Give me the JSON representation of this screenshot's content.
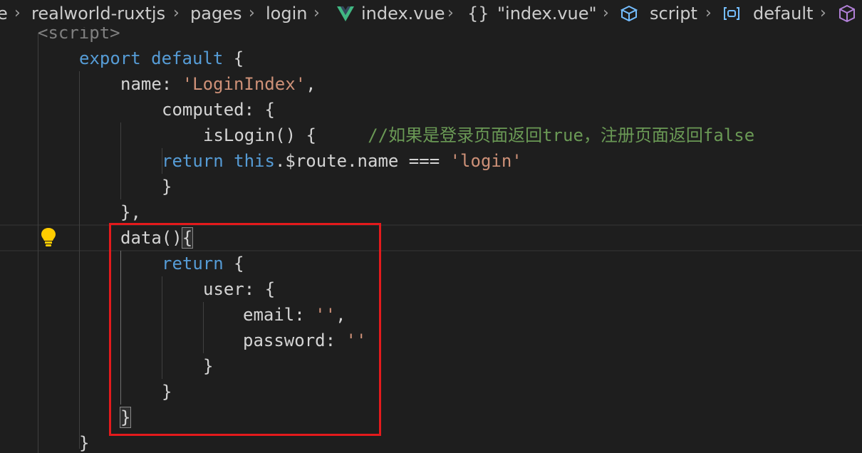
{
  "breadcrumb": {
    "items": [
      {
        "label": "e",
        "icon": null
      },
      {
        "label": "realworld-ruxtjs",
        "icon": null
      },
      {
        "label": "pages",
        "icon": null
      },
      {
        "label": "login",
        "icon": null
      },
      {
        "label": "index.vue",
        "icon": "vue-icon"
      },
      {
        "label": "\"index.vue\"",
        "icon": "braces-icon"
      },
      {
        "label": "script",
        "icon": "cube-icon"
      },
      {
        "label": "default",
        "icon": "object-icon"
      }
    ],
    "separator": "›",
    "braces_glyph": "{}",
    "colors": {
      "vue": "#41b883",
      "cube": "#75beff",
      "object": "#75beff",
      "module": "#b180d7"
    }
  },
  "code": {
    "lines": [
      {
        "tokens": [
          {
            "t": "<script>",
            "c": "tag"
          }
        ]
      },
      {
        "tokens": [
          {
            "t": "export",
            "c": "kw"
          },
          {
            "t": " ",
            "c": ""
          },
          {
            "t": "default",
            "c": "kw"
          },
          {
            "t": " {",
            "c": ""
          }
        ]
      },
      {
        "tokens": [
          {
            "t": "name: ",
            "c": ""
          },
          {
            "t": "'LoginIndex'",
            "c": "str"
          },
          {
            "t": ",",
            "c": ""
          }
        ]
      },
      {
        "tokens": [
          {
            "t": "computed: {",
            "c": ""
          }
        ]
      },
      {
        "tokens": [
          {
            "t": "isLogin() {",
            "c": ""
          },
          {
            "t": "     ",
            "c": ""
          },
          {
            "t": "//如果是登录页面返回true，注册页面返回false",
            "c": "cmt"
          }
        ]
      },
      {
        "tokens": [
          {
            "t": "return",
            "c": "kw"
          },
          {
            "t": " ",
            "c": ""
          },
          {
            "t": "this",
            "c": "kw"
          },
          {
            "t": ".$route.name === ",
            "c": ""
          },
          {
            "t": "'login'",
            "c": "str"
          }
        ]
      },
      {
        "tokens": [
          {
            "t": "}",
            "c": ""
          }
        ]
      },
      {
        "tokens": [
          {
            "t": "},",
            "c": ""
          }
        ]
      },
      {
        "tokens": [
          {
            "t": "data()",
            "c": ""
          },
          {
            "t": "{",
            "c": "match"
          }
        ]
      },
      {
        "tokens": [
          {
            "t": "return",
            "c": "kw"
          },
          {
            "t": " {",
            "c": ""
          }
        ]
      },
      {
        "tokens": [
          {
            "t": "user: {",
            "c": ""
          }
        ]
      },
      {
        "tokens": [
          {
            "t": "email: ",
            "c": ""
          },
          {
            "t": "''",
            "c": "str"
          },
          {
            "t": ",",
            "c": ""
          }
        ]
      },
      {
        "tokens": [
          {
            "t": "password: ",
            "c": ""
          },
          {
            "t": "''",
            "c": "str"
          }
        ]
      },
      {
        "tokens": [
          {
            "t": "}",
            "c": ""
          }
        ]
      },
      {
        "tokens": [
          {
            "t": "}",
            "c": ""
          }
        ]
      },
      {
        "tokens": [
          {
            "t": "}",
            "c": "match"
          }
        ]
      },
      {
        "tokens": [
          {
            "t": "}",
            "c": ""
          }
        ]
      }
    ]
  },
  "colors": {
    "background": "#1e1e1e",
    "keyword": "#569cd6",
    "string": "#ce9178",
    "comment": "#6a9955",
    "highlight_box": "#e41a1c",
    "lightbulb": "#ffcc00"
  }
}
